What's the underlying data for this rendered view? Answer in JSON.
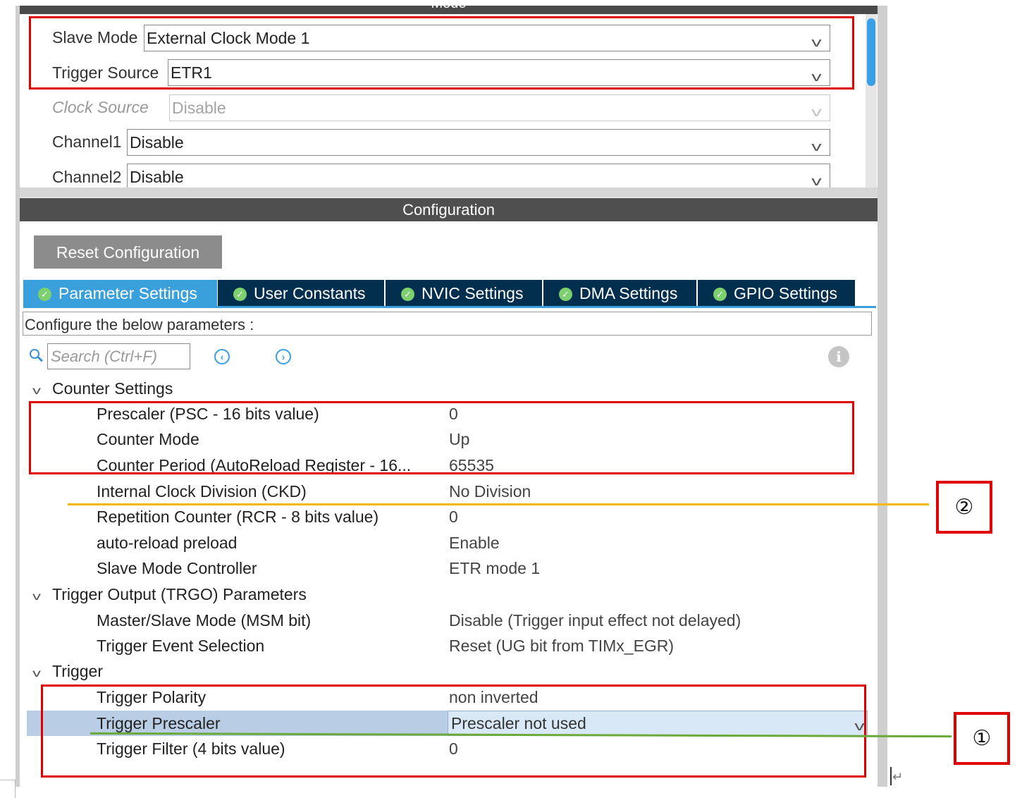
{
  "mode": {
    "title": "Mode",
    "fields": [
      {
        "label": "Slave Mode",
        "value": "External Clock Mode 1",
        "disabled": false
      },
      {
        "label": "Trigger Source",
        "value": "ETR1",
        "disabled": false
      },
      {
        "label": "Clock Source",
        "value": "Disable",
        "disabled": true
      },
      {
        "label": "Channel1",
        "value": "Disable",
        "disabled": false
      },
      {
        "label": "Channel2",
        "value": "Disable",
        "disabled": false
      }
    ]
  },
  "configuration": {
    "header": "Configuration",
    "reset_button": "Reset Configuration",
    "tabs": [
      {
        "label": "Parameter Settings",
        "active": true
      },
      {
        "label": "User Constants",
        "active": false
      },
      {
        "label": "NVIC Settings",
        "active": false
      },
      {
        "label": "DMA Settings",
        "active": false
      },
      {
        "label": "GPIO Settings",
        "active": false
      }
    ],
    "configure_label": "Configure the below parameters :",
    "search_placeholder": "Search (Ctrl+F)"
  },
  "groups": [
    {
      "title": "Counter Settings",
      "params": [
        {
          "name": "Prescaler (PSC - 16 bits value)",
          "value": "0"
        },
        {
          "name": "Counter Mode",
          "value": "Up"
        },
        {
          "name": "Counter Period (AutoReload Register - 16...",
          "value": "65535"
        },
        {
          "name": "Internal Clock Division (CKD)",
          "value": "No Division"
        },
        {
          "name": "Repetition Counter (RCR - 8 bits value)",
          "value": "0"
        },
        {
          "name": "auto-reload preload",
          "value": "Enable"
        },
        {
          "name": "Slave Mode Controller",
          "value": "ETR mode 1"
        }
      ]
    },
    {
      "title": "Trigger Output (TRGO) Parameters",
      "params": [
        {
          "name": "Master/Slave Mode (MSM bit)",
          "value": "Disable (Trigger input effect not delayed)"
        },
        {
          "name": "Trigger Event Selection",
          "value": "Reset (UG bit from TIMx_EGR)"
        }
      ]
    },
    {
      "title": "Trigger",
      "params": [
        {
          "name": "Trigger Polarity",
          "value": "non inverted"
        },
        {
          "name": "Trigger Prescaler",
          "value": "Prescaler not used",
          "selected": true
        },
        {
          "name": "Trigger Filter (4 bits value)",
          "value": "0"
        }
      ]
    }
  ],
  "annotations": {
    "marker_1": "①",
    "marker_2": "②",
    "box_color": "#e00000",
    "line_1_color": "#6aaa3a",
    "line_2_color": "#f5b800"
  },
  "colors": {
    "tab_active": "#3aa0dc",
    "tab_inactive": "#032f4f",
    "header_bg": "#4f4f4f",
    "selected_row": "#b9cde4",
    "check_icon": "#7dd06e"
  }
}
